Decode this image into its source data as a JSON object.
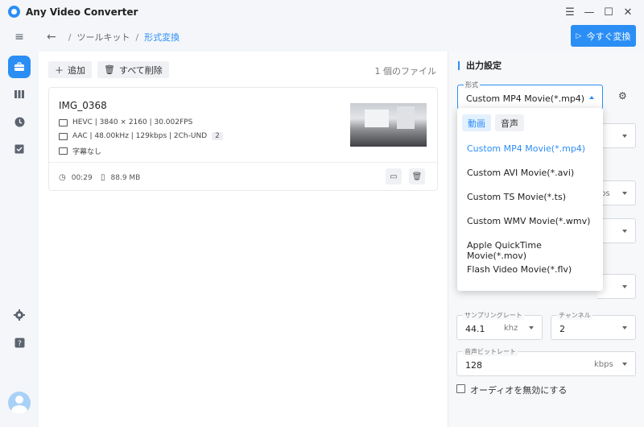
{
  "app": {
    "title": "Any Video Converter"
  },
  "window_controls": [
    "menu-icon",
    "minimize-icon",
    "maximize-icon",
    "close-icon"
  ],
  "sidebar": {
    "icons": [
      "collapse-menu-icon",
      "toolbox-icon",
      "library-icon",
      "history-icon",
      "tasks-icon",
      "settings-icon",
      "help-icon",
      "avatar"
    ]
  },
  "breadcrumb": {
    "parent": "ツールキット",
    "current": "形式変換"
  },
  "convert_button": {
    "label": "今すぐ変換"
  },
  "toolbar": {
    "add_label": "追加",
    "delete_all_label": "すべて削除",
    "file_count": "1 個のファイル"
  },
  "file": {
    "name": "IMG_0368",
    "video_info": "HEVC | 3840 × 2160 | 30.002FPS",
    "audio_info": "AAC | 48.00kHz | 129kbps | 2Ch-UND",
    "audio_tracks": "2",
    "subtitle_info": "字幕なし",
    "duration": "00:29",
    "size": "88.9 MB"
  },
  "settings": {
    "section_title": "出力設定",
    "format_label": "形式",
    "format_value": "Custom MP4 Movie(*.mp4)",
    "sample_rate_label": "サンプリングレート",
    "sample_rate_value": "44.1",
    "sample_rate_unit": "khz",
    "channel_label": "チャンネル",
    "channel_value": "2",
    "audio_bitrate_label": "音声ビットレート",
    "audio_bitrate_value": "128",
    "audio_bitrate_unit": "kbps",
    "hidden_field_unit": "ps",
    "disable_audio_label": "オーディオを無効にする"
  },
  "dropdown": {
    "tabs": [
      "動画",
      "音声"
    ],
    "active_tab": "動画",
    "items": [
      "Custom MP4 Movie(*.mp4)",
      "Custom AVI Movie(*.avi)",
      "Custom TS Movie(*.ts)",
      "Custom WMV Movie(*.wmv)",
      "Apple QuickTime Movie(*.mov)",
      "Flash Video Movie(*.flv)"
    ],
    "selected_item": "Custom MP4 Movie(*.mp4)"
  },
  "colors": {
    "accent": "#2b8ef5",
    "background": "#f4f6f9",
    "panel": "#ffffff"
  }
}
